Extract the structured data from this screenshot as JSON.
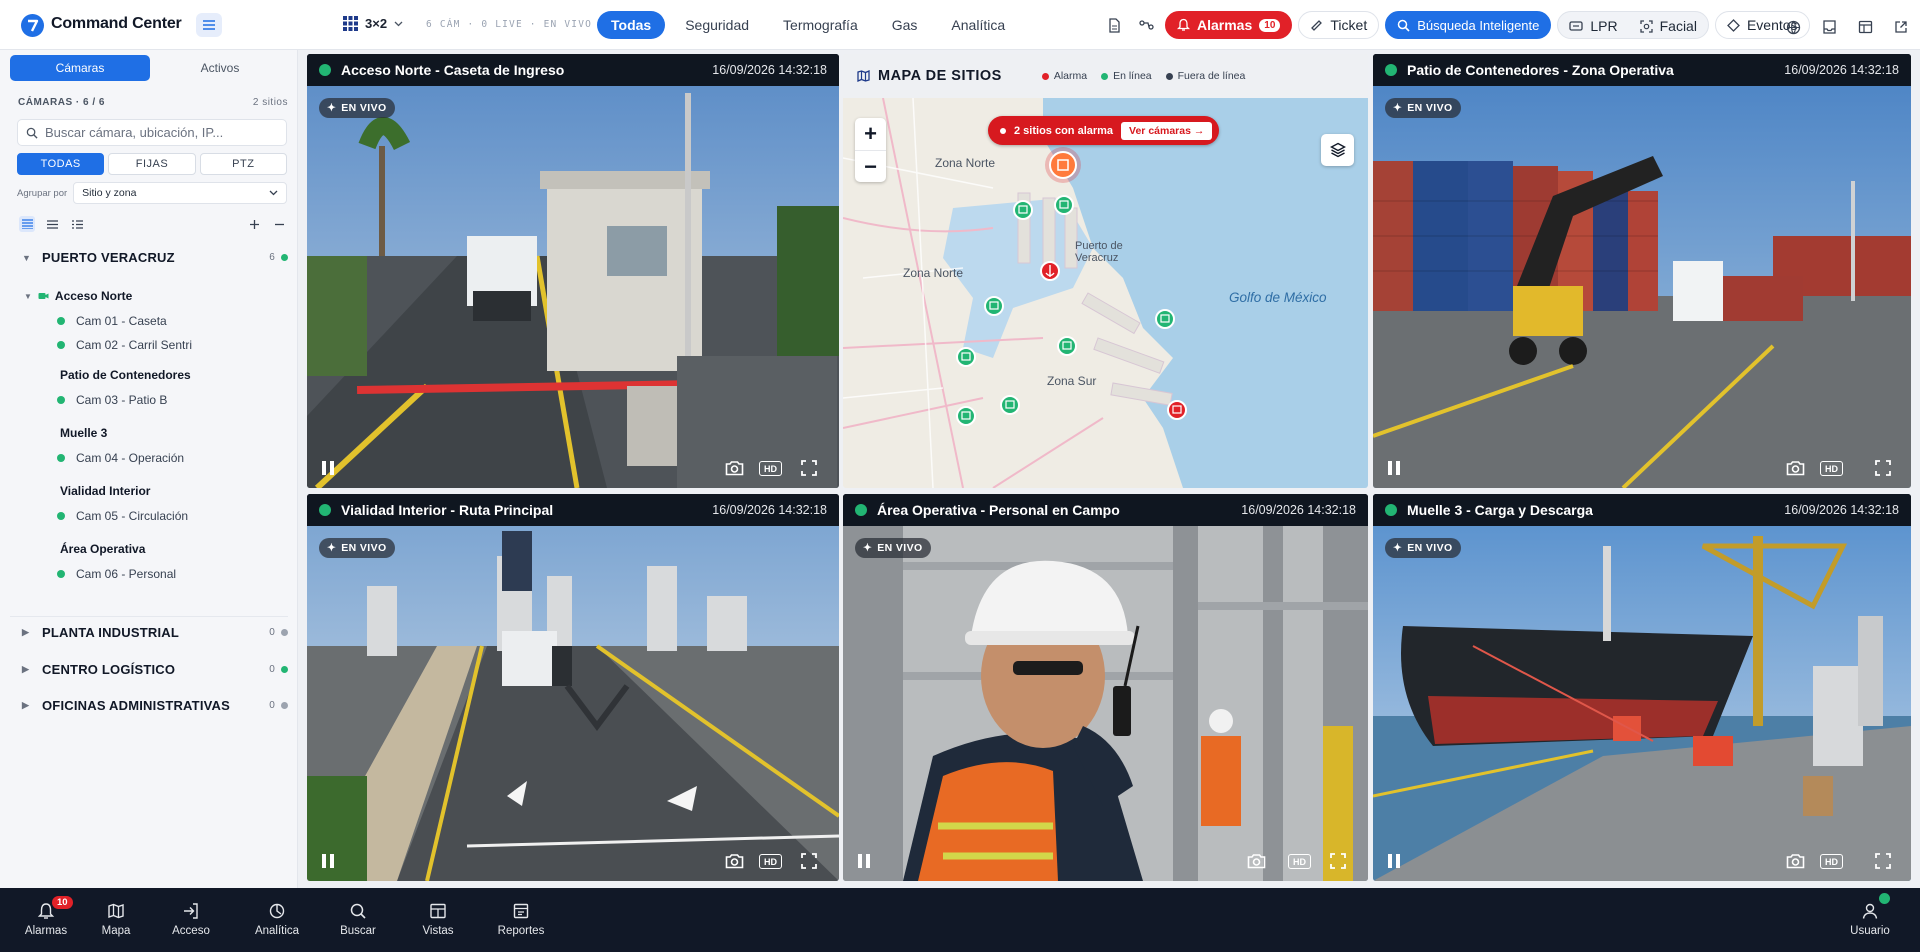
{
  "header": {
    "app_title": "Command Center",
    "grid_layout": "3×2",
    "camera_status": "6 CÁM · 0 LIVE · EN VIVO",
    "filter_tabs": [
      "Todas",
      "Seguridad",
      "Termografía",
      "Gas",
      "Analítica"
    ],
    "active_filter": "Todas",
    "alarms_label": "Alarmas",
    "alarms_count": "10",
    "ticket_label": "Ticket",
    "smart_search_label": "Búsqueda Inteligente",
    "lpr_label": "LPR",
    "facial_label": "Facial",
    "events_label": "Eventos",
    "accent_color": "#1f6fe5",
    "alarm_color": "#e12128"
  },
  "sidebar": {
    "tabs": [
      "Cámaras",
      "Activos"
    ],
    "cameras_heading": "CÁMARAS · 6 / 6",
    "sites_count": "2 sitios",
    "search_placeholder": "Buscar cámara, ubicación, IP...",
    "type_filters": [
      "TODAS",
      "FIJAS",
      "PTZ"
    ],
    "group_by_label": "Agrupar por",
    "group_by_value": "Sitio y zona",
    "sites": [
      {
        "name": "PUERTO VERACRUZ",
        "count": "6",
        "status_color": "#22b573",
        "zones": [
          {
            "name": "Acceso Norte",
            "cameras": [
              "Cam 01 - Caseta",
              "Cam 02 - Carril Sentri"
            ]
          },
          {
            "name": "Patio de Contenedores",
            "cameras": [
              "Cam 03 - Patio B"
            ]
          },
          {
            "name": "Muelle 3",
            "cameras": [
              "Cam 04 - Operación"
            ]
          },
          {
            "name": "Vialidad Interior",
            "cameras": [
              "Cam 05 - Circulación"
            ]
          },
          {
            "name": "Área Operativa",
            "cameras": [
              "Cam 06 - Personal"
            ]
          }
        ]
      },
      {
        "name": "PLANTA INDUSTRIAL",
        "count": "0",
        "status_color": "#9ca3af"
      },
      {
        "name": "CENTRO LOGÍSTICO",
        "count": "0",
        "status_color": "#22b573"
      },
      {
        "name": "OFICINAS ADMINISTRATIVAS",
        "count": "0",
        "status_color": "#9ca3af"
      }
    ]
  },
  "tiles": [
    {
      "title": "Acceso Norte - Caseta de Ingreso",
      "timestamp": "16/09/2026 14:32:18",
      "live": "EN VIVO",
      "hd": "HD"
    },
    {
      "title": "Patio de Contenedores - Zona Operativa",
      "timestamp": "16/09/2026 14:32:18",
      "live": "EN VIVO",
      "hd": "HD"
    },
    {
      "title": "Vialidad Interior - Ruta Principal",
      "timestamp": "16/09/2026 14:32:18",
      "live": "EN VIVO",
      "hd": "HD"
    },
    {
      "title": "Área Operativa - Personal en Campo",
      "timestamp": "16/09/2026 14:32:18",
      "live": "EN VIVO",
      "hd": "HD"
    },
    {
      "title": "Muelle 3 - Carga y Descarga",
      "timestamp": "16/09/2026 14:32:18",
      "live": "EN VIVO",
      "hd": "HD"
    }
  ],
  "map": {
    "title": "MAPA DE SITIOS",
    "legend": [
      {
        "label": "Alarma",
        "color": "#e12128"
      },
      {
        "label": "En línea",
        "color": "#22b573"
      },
      {
        "label": "Fuera de línea",
        "color": "#374151"
      }
    ],
    "alarm_banner": "2 sitios con alarma",
    "view_cameras": "Ver cámaras →",
    "labels": [
      "Zona Norte",
      "Zona Norte",
      "Puerto de Veracruz",
      "Zona Sur"
    ],
    "sea_label": "Golfo de México"
  },
  "bottom_nav": [
    {
      "label": "Alarmas",
      "icon": "bell-icon",
      "badge": "10"
    },
    {
      "label": "Mapa",
      "icon": "map-icon"
    },
    {
      "label": "Acceso",
      "icon": "login-icon"
    },
    {
      "label": "Analítica",
      "icon": "analytics-icon"
    },
    {
      "label": "Buscar",
      "icon": "search-icon"
    },
    {
      "label": "Vistas",
      "icon": "layout-icon"
    },
    {
      "label": "Reportes",
      "icon": "report-icon"
    },
    {
      "label": "Usuario",
      "icon": "user-icon"
    }
  ]
}
